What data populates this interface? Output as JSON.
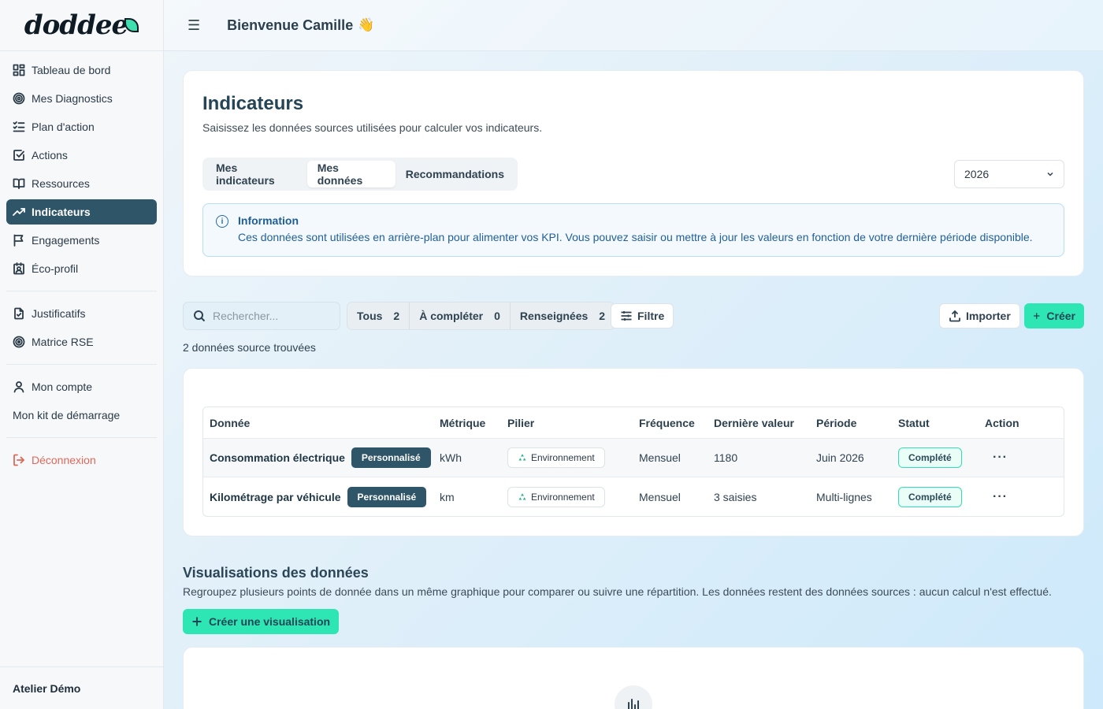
{
  "brand": {
    "logo": "doddee"
  },
  "sidebar": {
    "items": [
      {
        "label": "Tableau de bord",
        "icon": "dashboard-icon"
      },
      {
        "label": "Mes Diagnostics",
        "icon": "target-icon"
      },
      {
        "label": "Plan d'action",
        "icon": "list-checks-icon"
      },
      {
        "label": "Actions",
        "icon": "check-square-icon"
      },
      {
        "label": "Ressources",
        "icon": "book-icon"
      },
      {
        "label": "Indicateurs",
        "icon": "trend-icon",
        "active": true
      },
      {
        "label": "Engagements",
        "icon": "flag-icon"
      },
      {
        "label": "Éco-profil",
        "icon": "badge-icon"
      }
    ],
    "secondary": [
      {
        "label": "Justificatifs",
        "icon": "file-check-icon"
      },
      {
        "label": "Matrice RSE",
        "icon": "radar-icon"
      }
    ],
    "account": {
      "label": "Mon compte",
      "icon": "user-icon"
    },
    "starter_kit": "Mon kit de démarrage",
    "logout": {
      "label": "Déconnexion",
      "icon": "logout-icon"
    },
    "footer": "Atelier Démo"
  },
  "header": {
    "welcome": "Bienvenue Camille",
    "emoji": "👋"
  },
  "page": {
    "title": "Indicateurs",
    "subtitle": "Saisissez les données sources utilisées pour calculer vos indicateurs.",
    "tabs": [
      "Mes indicateurs",
      "Mes données",
      "Recommandations"
    ],
    "active_tab": "Mes données",
    "year": "2026",
    "info": {
      "title": "Information",
      "text": "Ces données sont utilisées en arrière-plan pour alimenter vos KPI. Vous pouvez saisir ou mettre à jour les valeurs en fonction de votre dernière période disponible."
    }
  },
  "toolbar": {
    "search_placeholder": "Rechercher...",
    "segments": [
      {
        "label": "Tous",
        "count": "2"
      },
      {
        "label": "À compléter",
        "count": "0"
      },
      {
        "label": "Renseignées",
        "count": "2"
      }
    ],
    "filter_label": "Filtre",
    "import_label": "Importer",
    "create_label": "Créer",
    "found_text": "2 données source trouvées"
  },
  "table": {
    "headers": [
      "Donnée",
      "Métrique",
      "Pilier",
      "Fréquence",
      "Dernière valeur",
      "Période",
      "Statut",
      "Action"
    ],
    "rows": [
      {
        "name": "Consommation électrique",
        "tag": "Personnalisé",
        "metric": "kWh",
        "pillar": "Environnement",
        "frequency": "Mensuel",
        "last_value": "1180",
        "period": "Juin 2026",
        "status": "Complété"
      },
      {
        "name": "Kilométrage par véhicule",
        "tag": "Personnalisé",
        "metric": "km",
        "pillar": "Environnement",
        "frequency": "Mensuel",
        "last_value": "3 saisies",
        "period": "Multi-lignes",
        "status": "Complété"
      }
    ],
    "action_glyph": "···"
  },
  "viz": {
    "title": "Visualisations des données",
    "subtitle": "Regroupez plusieurs points de donnée dans un même graphique pour comparer ou suivre une répartition. Les données restent des données sources : aucun calcul n'est effectué.",
    "create_label": "Créer une visualisation"
  },
  "colors": {
    "primary": "#2f5568",
    "accent": "#2ee6b3",
    "info": "#1f5d96",
    "danger": "#e0675a"
  }
}
